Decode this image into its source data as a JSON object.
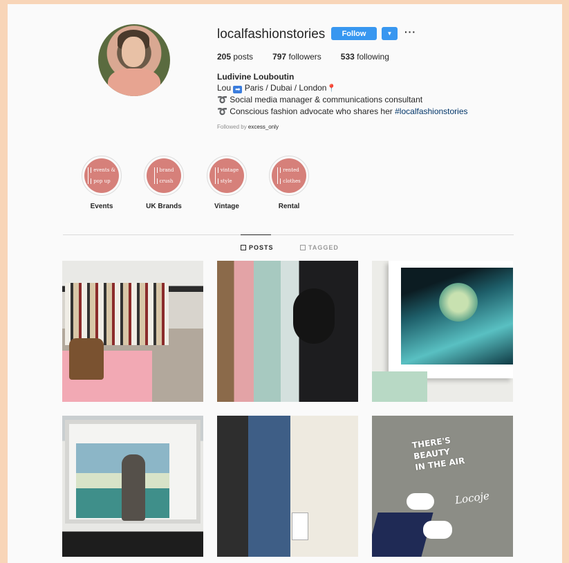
{
  "profile": {
    "username": "localfashionstories",
    "follow_label": "Follow",
    "more_label": "···",
    "posts_count": "205",
    "posts_label": "posts",
    "followers_count": "797",
    "followers_label": "followers",
    "following_count": "533",
    "following_label": "following",
    "full_name": "Ludivine Louboutin",
    "bio": {
      "line1_prefix": "Lou",
      "line1_arrow": "➡",
      "line1_text": "Paris / Dubai / London",
      "line1_pin": "📍",
      "line2_bullet": "➰",
      "line2_text": "Social media manager & communications consultant",
      "line3_bullet": "➰",
      "line3_text": "Conscious fashion advocate who shares her",
      "line3_hashtag": "#localfashionstories"
    },
    "followed_by_prefix": "Followed by",
    "followed_by_user": "excess_only"
  },
  "highlights": [
    {
      "label": "Events",
      "cover_line1": "events &",
      "cover_line2": "pop up"
    },
    {
      "label": "UK Brands",
      "cover_line1": "brand",
      "cover_line2": "crush"
    },
    {
      "label": "Vintage",
      "cover_line1": "vintage",
      "cover_line2": "style"
    },
    {
      "label": "Rental",
      "cover_line1": "rented",
      "cover_line2": "clothes"
    }
  ],
  "tabs": {
    "posts": "POSTS",
    "tagged": "TAGGED"
  },
  "posts": {
    "p6_sign_line1": "THERE'S",
    "p6_sign_line2": "BEAUTY",
    "p6_sign_line3": "IN THE AIR",
    "p6_script": "Locoje"
  },
  "colors": {
    "follow_blue": "#3897f0",
    "highlight_pink": "#d6807a",
    "frame_peach": "#f8d5b8",
    "hashtag_blue": "#003569"
  }
}
